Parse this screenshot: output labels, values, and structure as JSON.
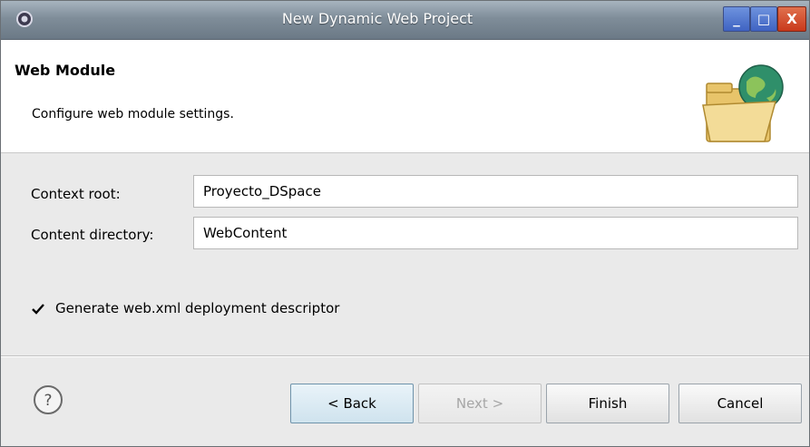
{
  "window": {
    "title": "New Dynamic Web Project",
    "controls": {
      "minimize": "_",
      "maximize": "□",
      "close": "X"
    }
  },
  "header": {
    "title": "Web Module",
    "description": "Configure web module settings.",
    "icon": "folder-globe-icon"
  },
  "form": {
    "context_root": {
      "label": "Context root:",
      "value": "Proyecto_DSpace"
    },
    "content_directory": {
      "label": "Content directory:",
      "value": "WebContent"
    },
    "generate_descriptor": {
      "label": "Generate web.xml deployment descriptor",
      "checked": true
    }
  },
  "footer": {
    "help_icon": "help-icon",
    "back_label": "< Back",
    "next_label": "Next >",
    "finish_label": "Finish",
    "cancel_label": "Cancel"
  },
  "colors": {
    "titlebar": "#7f8d99",
    "close_button": "#c9391b",
    "window_button": "#3f63c2",
    "focused_button": "#cfe3ee"
  }
}
